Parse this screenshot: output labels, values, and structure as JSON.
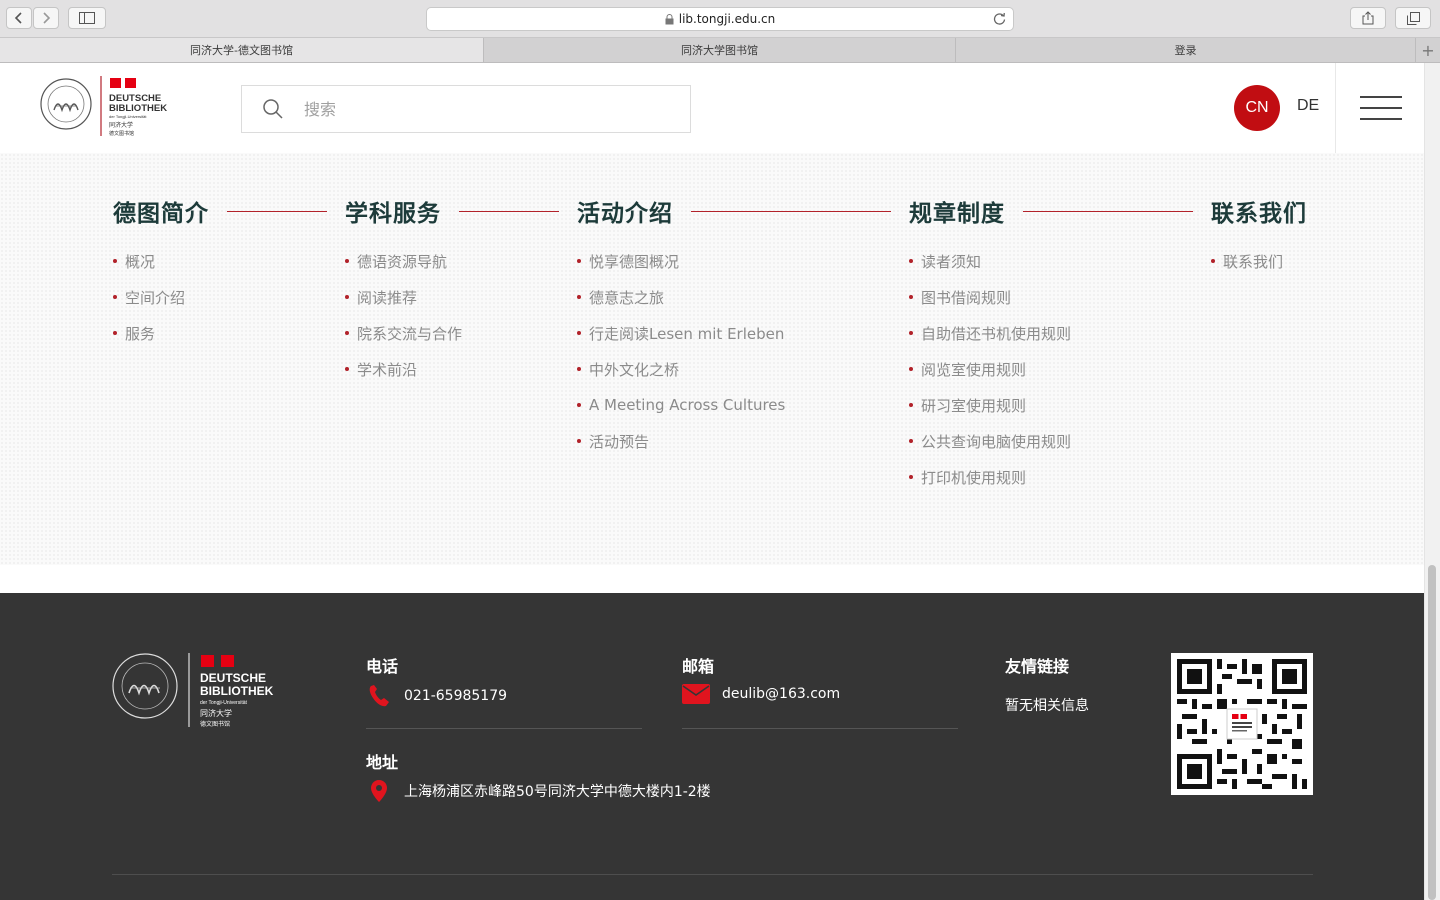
{
  "browser": {
    "url": "lib.tongji.edu.cn",
    "tabs": [
      {
        "label": "同济大学-德文图书馆",
        "active": true
      },
      {
        "label": "同济大学图书馆",
        "active": false
      },
      {
        "label": "登录",
        "active": false
      }
    ]
  },
  "header": {
    "logo_text": {
      "line1": "DEUTSCHE",
      "line2": "BIBLIOTHEK",
      "line3": "der Tongji-Universität",
      "line4": "同济大学",
      "line5": "德文图书馆"
    },
    "search_placeholder": "搜索",
    "lang_cn": "CN",
    "lang_de": "DE"
  },
  "menu": {
    "accent_color": "#b2222a",
    "columns": [
      {
        "title": "德图简介",
        "items": [
          "概况",
          "空间介绍",
          "服务"
        ]
      },
      {
        "title": "学科服务",
        "items": [
          "德语资源导航",
          "阅读推荐",
          "院系交流与合作",
          "学术前沿"
        ]
      },
      {
        "title": "活动介绍",
        "items": [
          "悦享德图概况",
          "德意志之旅",
          "行走阅读Lesen mit Erleben",
          "中外文化之桥",
          "A Meeting Across Cultures",
          "活动预告"
        ]
      },
      {
        "title": "规章制度",
        "items": [
          "读者须知",
          "图书借阅规则",
          "自助借还书机使用规则",
          "阅览室使用规则",
          "研习室使用规则",
          "公共查询电脑使用规则",
          "打印机使用规则"
        ]
      },
      {
        "title": "联系我们",
        "items": [
          "联系我们"
        ]
      }
    ]
  },
  "footer": {
    "phone_label": "电话",
    "phone": "021-65985179",
    "email_label": "邮箱",
    "email": "deulib@163.com",
    "address_label": "地址",
    "address": "上海杨浦区赤峰路50号同济大学中德大楼内1-2楼",
    "links_label": "友情链接",
    "links_text": "暂无相关信息"
  },
  "colors": {
    "brand_red": "#c10d12",
    "footer_bg": "#353535"
  }
}
